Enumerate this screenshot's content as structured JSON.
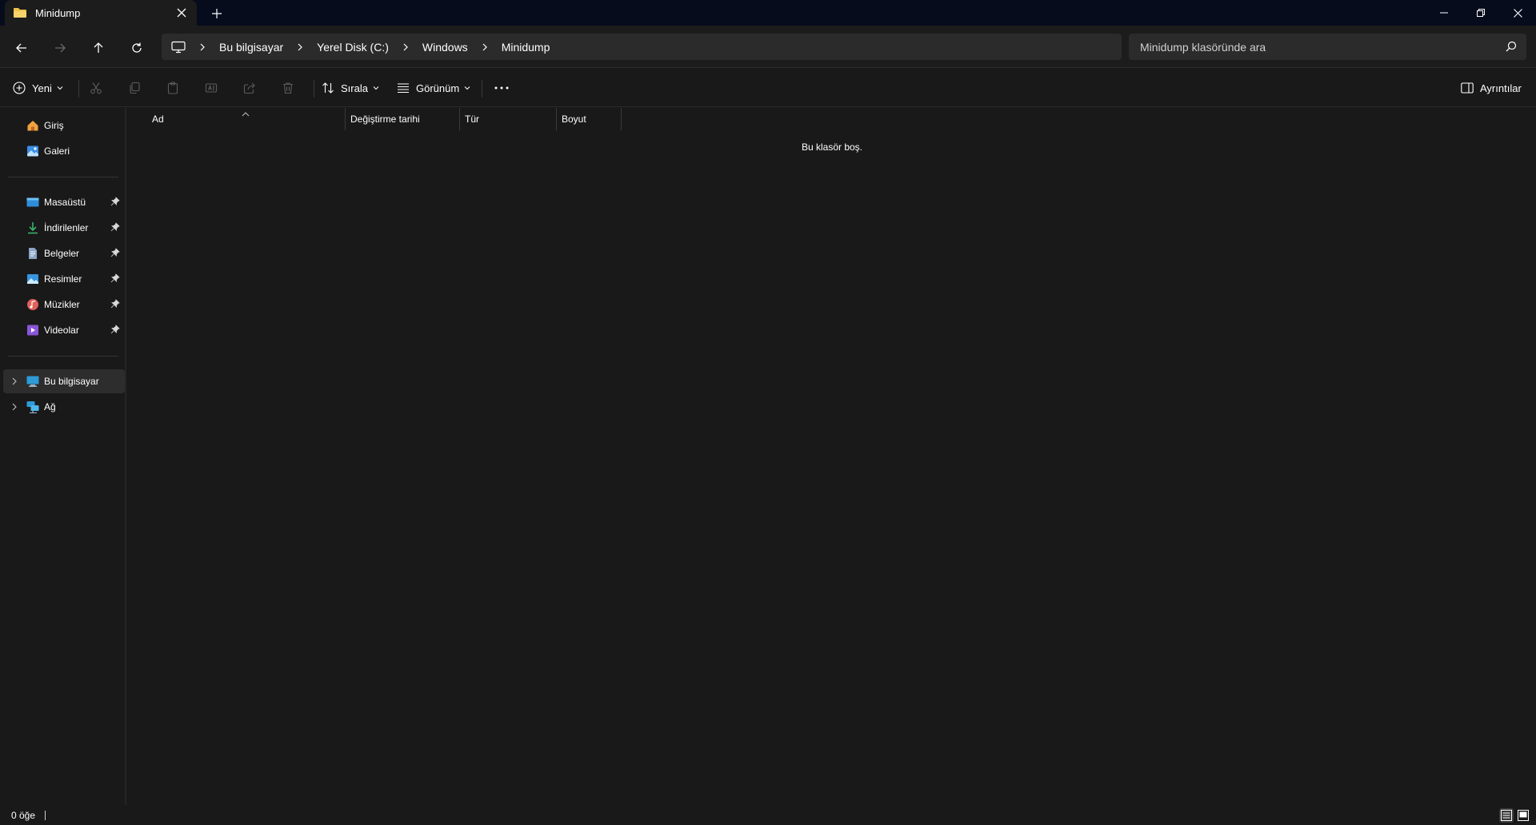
{
  "tab": {
    "title": "Minidump",
    "icon": "folder-icon"
  },
  "navigation": {
    "breadcrumbs": [
      "Bu bilgisayar",
      "Yerel Disk (C:)",
      "Windows",
      "Minidump"
    ],
    "search_placeholder": "Minidump klasöründe ara"
  },
  "commands": {
    "new_label": "Yeni",
    "sort_label": "Sırala",
    "view_label": "Görünüm",
    "details_label": "Ayrıntılar"
  },
  "sidebar": {
    "quick": [
      {
        "label": "Giriş",
        "icon": "home-icon"
      },
      {
        "label": "Galeri",
        "icon": "gallery-icon"
      }
    ],
    "pinned": [
      {
        "label": "Masaüstü",
        "icon": "desktop-icon"
      },
      {
        "label": "İndirilenler",
        "icon": "downloads-icon"
      },
      {
        "label": "Belgeler",
        "icon": "documents-icon"
      },
      {
        "label": "Resimler",
        "icon": "pictures-icon"
      },
      {
        "label": "Müzikler",
        "icon": "music-icon"
      },
      {
        "label": "Videolar",
        "icon": "videos-icon"
      }
    ],
    "locations": [
      {
        "label": "Bu bilgisayar",
        "icon": "computer-icon",
        "selected": true
      },
      {
        "label": "Ağ",
        "icon": "network-icon",
        "selected": false
      }
    ]
  },
  "columns": [
    "Ad",
    "Değiştirme tarihi",
    "Tür",
    "Boyut"
  ],
  "empty_message": "Bu klasör boş.",
  "status": {
    "item_count": "0 öğe"
  },
  "colors": {
    "background": "#191919",
    "titlebar": "#060c1c",
    "accent_folder": "#f0c24b",
    "address_bg": "#2b2b2b"
  }
}
